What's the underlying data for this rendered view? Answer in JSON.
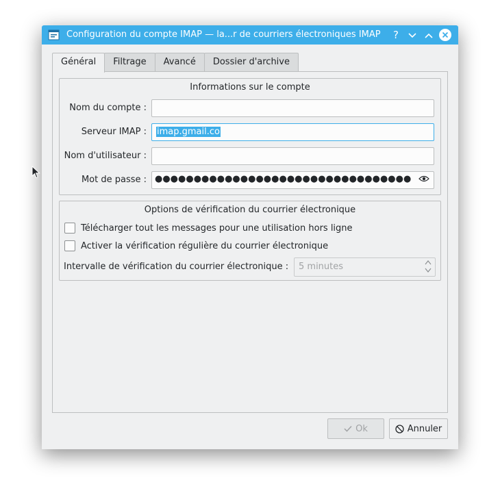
{
  "window": {
    "title": "Configuration du compte IMAP — la...r de courriers électroniques IMAP",
    "help_label": "?",
    "accent": "#3daee9"
  },
  "tabs": [
    {
      "label": "Général",
      "active": true
    },
    {
      "label": "Filtrage",
      "active": false
    },
    {
      "label": "Avancé",
      "active": false
    },
    {
      "label": "Dossier d'archive",
      "active": false
    }
  ],
  "account_info": {
    "title": "Informations sur le compte",
    "name_label": "Nom du compte :",
    "name_value": "",
    "server_label": "Serveur IMAP :",
    "server_value": "imap.gmail.co",
    "user_label": "Nom d'utilisateur :",
    "user_value": "",
    "password_label": "Mot de passe :",
    "password_mask": "●●●●●●●●●●●●●●●●●●●●●●●●●●●●●●●●●●●●"
  },
  "check_options": {
    "title": "Options de vérification du courrier électronique",
    "offline_label": "Télécharger tout les messages pour une utilisation hors ligne",
    "offline_checked": false,
    "periodic_label": "Activer la vérification régulière du courrier électronique",
    "periodic_checked": false,
    "interval_label": "Intervalle de vérification du courrier électronique :",
    "interval_value": "5 minutes"
  },
  "buttons": {
    "ok_label": "Ok",
    "cancel_label": "Annuler"
  }
}
